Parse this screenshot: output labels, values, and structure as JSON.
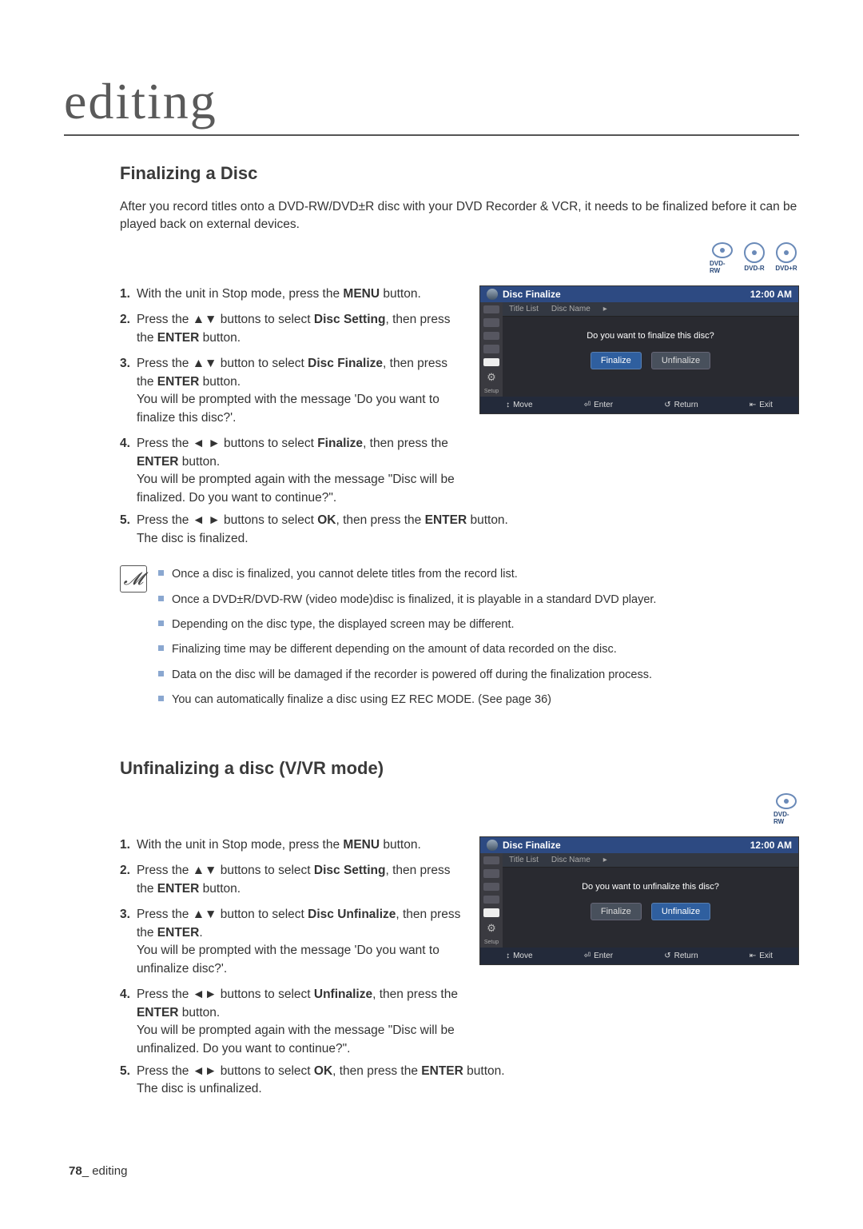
{
  "chapter_label": "editing",
  "section_a": {
    "title": "Finalizing a Disc",
    "intro": "After you record titles onto a DVD-RW/DVD±R disc with your DVD Recorder & VCR, it needs to be finalized before it can be played back on external devices.",
    "badges": [
      "DVD-RW",
      "DVD-R",
      "DVD+R"
    ],
    "steps": [
      "With the unit in Stop mode, press the <b>MENU</b> button.",
      "Press the ▲▼ buttons to select <b>Disc Setting</b>, then press the <b>ENTER</b> button.",
      "Press the ▲▼ button to select <b>Disc Finalize</b>, then press the <b>ENTER</b> button.<br>You will be prompted with the message 'Do you want to finalize this disc?'.",
      "Press the ◄ ► buttons to select <b>Finalize</b>, then press the <b>ENTER</b> button.<br>You will be prompted again with the message \"Disc will be finalized. Do you want to continue?\".",
      "Press the ◄ ► buttons to select <b>OK</b>, then press the <b>ENTER</b> button.<br>The disc is finalized."
    ],
    "notes": [
      "Once a disc is finalized, you cannot delete titles from the record list.",
      "Once a DVD±R/DVD-RW (video mode)disc is finalized, it is playable in a standard DVD player.",
      "Depending on the disc type, the displayed screen may be different.",
      "Finalizing time may be different depending on the amount of data recorded on the disc.",
      "Data on the disc will be damaged if the recorder is powered off during the finalization process.",
      "You can automatically finalize a disc using EZ REC MODE. (See page 36)"
    ],
    "osd": {
      "title": "Disc Finalize",
      "clock": "12:00 AM",
      "row_left": "Title List",
      "row_right": "Disc Name",
      "question": "Do you want to finalize this disc?",
      "primary": "Finalize",
      "secondary": "Unfinalize",
      "footer": {
        "move": "Move",
        "enter": "Enter",
        "return": "Return",
        "exit": "Exit"
      },
      "setup": "Setup"
    }
  },
  "section_b": {
    "title": "Unfinalizing a disc (V/VR mode)",
    "badges": [
      "DVD-RW"
    ],
    "steps": [
      "With the unit in Stop mode, press the <b>MENU</b> button.",
      "Press the ▲▼ buttons to select <b>Disc Setting</b>, then press the <b>ENTER</b> button.",
      "Press the ▲▼ button to select <b>Disc Unfinalize</b>, then press the <b>ENTER</b>.<br>You will be prompted with the message 'Do you want to unfinalize disc?'.",
      "Press the ◄► buttons to select <b>Unfinalize</b>, then press the <b>ENTER</b> button.<br>You will be prompted again with the message \"Disc will be unfinalized. Do you want to continue?\".",
      "Press the ◄► buttons to select <b>OK</b>, then press the <b>ENTER</b> button.<br>The disc is unfinalized."
    ],
    "osd": {
      "title": "Disc Finalize",
      "clock": "12:00 AM",
      "row_left": "Title List",
      "row_right": "Disc Name",
      "question": "Do you want to unfinalize this disc?",
      "primary": "Finalize",
      "secondary": "Unfinalize",
      "footer": {
        "move": "Move",
        "enter": "Enter",
        "return": "Return",
        "exit": "Exit"
      },
      "setup": "Setup"
    }
  },
  "footer": {
    "page_num": "78",
    "section": "editing",
    "sep": "_"
  }
}
